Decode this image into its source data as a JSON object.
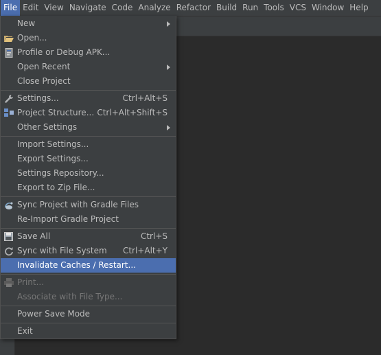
{
  "menubar": {
    "items": [
      "File",
      "Edit",
      "View",
      "Navigate",
      "Code",
      "Analyze",
      "Refactor",
      "Build",
      "Run",
      "Tools",
      "VCS",
      "Window",
      "Help"
    ]
  },
  "file_menu": {
    "new": "New",
    "open": "Open...",
    "profile_debug": "Profile or Debug APK...",
    "open_recent": "Open Recent",
    "close_project": "Close Project",
    "settings": "Settings...",
    "settings_shortcut": "Ctrl+Alt+S",
    "project_structure": "Project Structure...",
    "project_structure_shortcut": "Ctrl+Alt+Shift+S",
    "other_settings": "Other Settings",
    "import_settings": "Import Settings...",
    "export_settings": "Export Settings...",
    "settings_repository": "Settings Repository...",
    "export_zip": "Export to Zip File...",
    "sync_gradle": "Sync Project with Gradle Files",
    "reimport_gradle": "Re-Import Gradle Project",
    "save_all": "Save All",
    "save_all_shortcut": "Ctrl+S",
    "sync_fs": "Sync with File System",
    "sync_fs_shortcut": "Ctrl+Alt+Y",
    "invalidate": "Invalidate Caches / Restart...",
    "print": "Print...",
    "associate": "Associate with File Type...",
    "power_save": "Power Save Mode",
    "exit": "Exit"
  },
  "colors": {
    "accent": "#4b6eaf",
    "background": "#2b2b2b",
    "panel": "#3c3f41"
  },
  "icons": {
    "open": "folder-icon",
    "profile": "apk-icon",
    "settings": "wrench-icon",
    "project_structure": "project-structure-icon",
    "sync_gradle": "gradle-sync-icon",
    "save_all": "floppy-disk-icon",
    "sync_fs": "refresh-icon",
    "print": "printer-icon"
  }
}
